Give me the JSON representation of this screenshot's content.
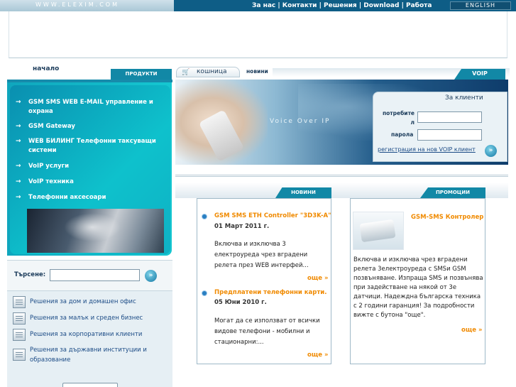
{
  "topbar": {
    "url": "WWW.ELEXIM.COM",
    "nav": [
      "За нас",
      "Контакти",
      "Решения",
      "Download",
      "Работа"
    ],
    "separator": " | ",
    "language": "ENGLISH"
  },
  "sidebar": {
    "home": "начало",
    "products_tab": "ПРОДУКТИ",
    "menu": [
      "GSM SMS WEB E-MAIL управление и охрана",
      "GSM Gateway",
      "WEB БИЛИНГ Телефонни таксуващи системи",
      "VoIP услуги",
      "VoIP техника",
      "Телефонни аксесоари"
    ],
    "search_label": "Търсене:",
    "search_placeholder": "",
    "solutions": [
      "Решения за дом и домашен офис",
      "Решения за малък и среден бизнес",
      "Решения за корпоративни клиенти",
      "Решения за държавни институции и образование"
    ]
  },
  "tabs": {
    "cart": "кошница",
    "news": "новини",
    "voip": "VOIP"
  },
  "hero": {
    "text": "Voice Over IP"
  },
  "clients": {
    "title": "За клиенти",
    "user_label": "потребите л",
    "pass_label": "парола",
    "register_link": "регистрация на нов VOIP клиент"
  },
  "sections": {
    "news_header": "НОВИНИ",
    "promo_header": "ПРОМОЦИИ"
  },
  "news": [
    {
      "title": "GSM SMS ETH Controller \"3D3K-A\"",
      "date": "01 Март 2011 г.",
      "body": "Включва и изключва 3 електроуреда чрез вградени релета през WEB интерфей...",
      "more": "още »"
    },
    {
      "title": "Предплатени телефонни карти.",
      "date": "05 Юни 2010 г.",
      "body": "Могат да се използват от всички видове телефони - мобилни и стационарни:...",
      "more": "още »"
    }
  ],
  "promo": {
    "title": "GSM-SMS Контролер",
    "body": "Включва и изключва чрез вградени релета 3електроуреда с SMSи GSM позвъняване. Изпраща SMS и позвънява при задействане на някой от 3е датчици. Надеждна българска техника с 2 години гаранция! За подробности вижте с бутона \"още\".",
    "more": "още »"
  },
  "colors": {
    "brand_blue": "#1288a6",
    "topbar": "#0e5d86",
    "accent_orange": "#f08a00",
    "menu_cyan": "#15c7d1"
  },
  "icons": {
    "go": "double-chevron-right-icon",
    "cart": "shopping-cart-icon",
    "bullet": "blue-dot-bullet-icon",
    "doc": "document-icon"
  }
}
